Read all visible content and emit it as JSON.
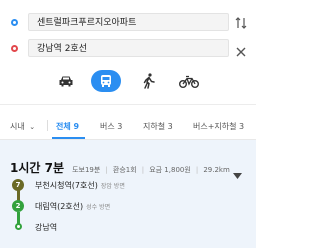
{
  "route_inputs": {
    "origin": "센트럴파크푸르지오아파트",
    "destination": "강남역 2호선"
  },
  "modes": [
    {
      "name": "car",
      "active": false
    },
    {
      "name": "transit",
      "active": true
    },
    {
      "name": "walk",
      "active": false
    },
    {
      "name": "bike",
      "active": false
    }
  ],
  "filter": {
    "area": "시내"
  },
  "tabs": [
    {
      "label": "전체 9",
      "active": true
    },
    {
      "label": "버스 3",
      "active": false
    },
    {
      "label": "지하철 3",
      "active": false
    },
    {
      "label": "버스+지하철 3",
      "active": false
    }
  ],
  "route": {
    "duration": "1시간 7분",
    "walk": "도보19분",
    "transfer": "환승1회",
    "fare": "요금 1,800원",
    "distance": "29.2km",
    "stops": [
      {
        "badge": "7",
        "color": "#6b6a26",
        "name": "부천시청역(7호선)",
        "direction": "장암 방면"
      },
      {
        "badge": "2",
        "color": "#33a23d",
        "name": "대림역(2호선)",
        "direction": "성수 방면"
      },
      {
        "badge": "",
        "color": "#33a23d",
        "name": "강남역",
        "direction": ""
      }
    ]
  },
  "colors": {
    "accent": "#2b8ef1",
    "line7": "#6b6a26",
    "line2": "#33a23d",
    "panel": "#eef4fb"
  }
}
